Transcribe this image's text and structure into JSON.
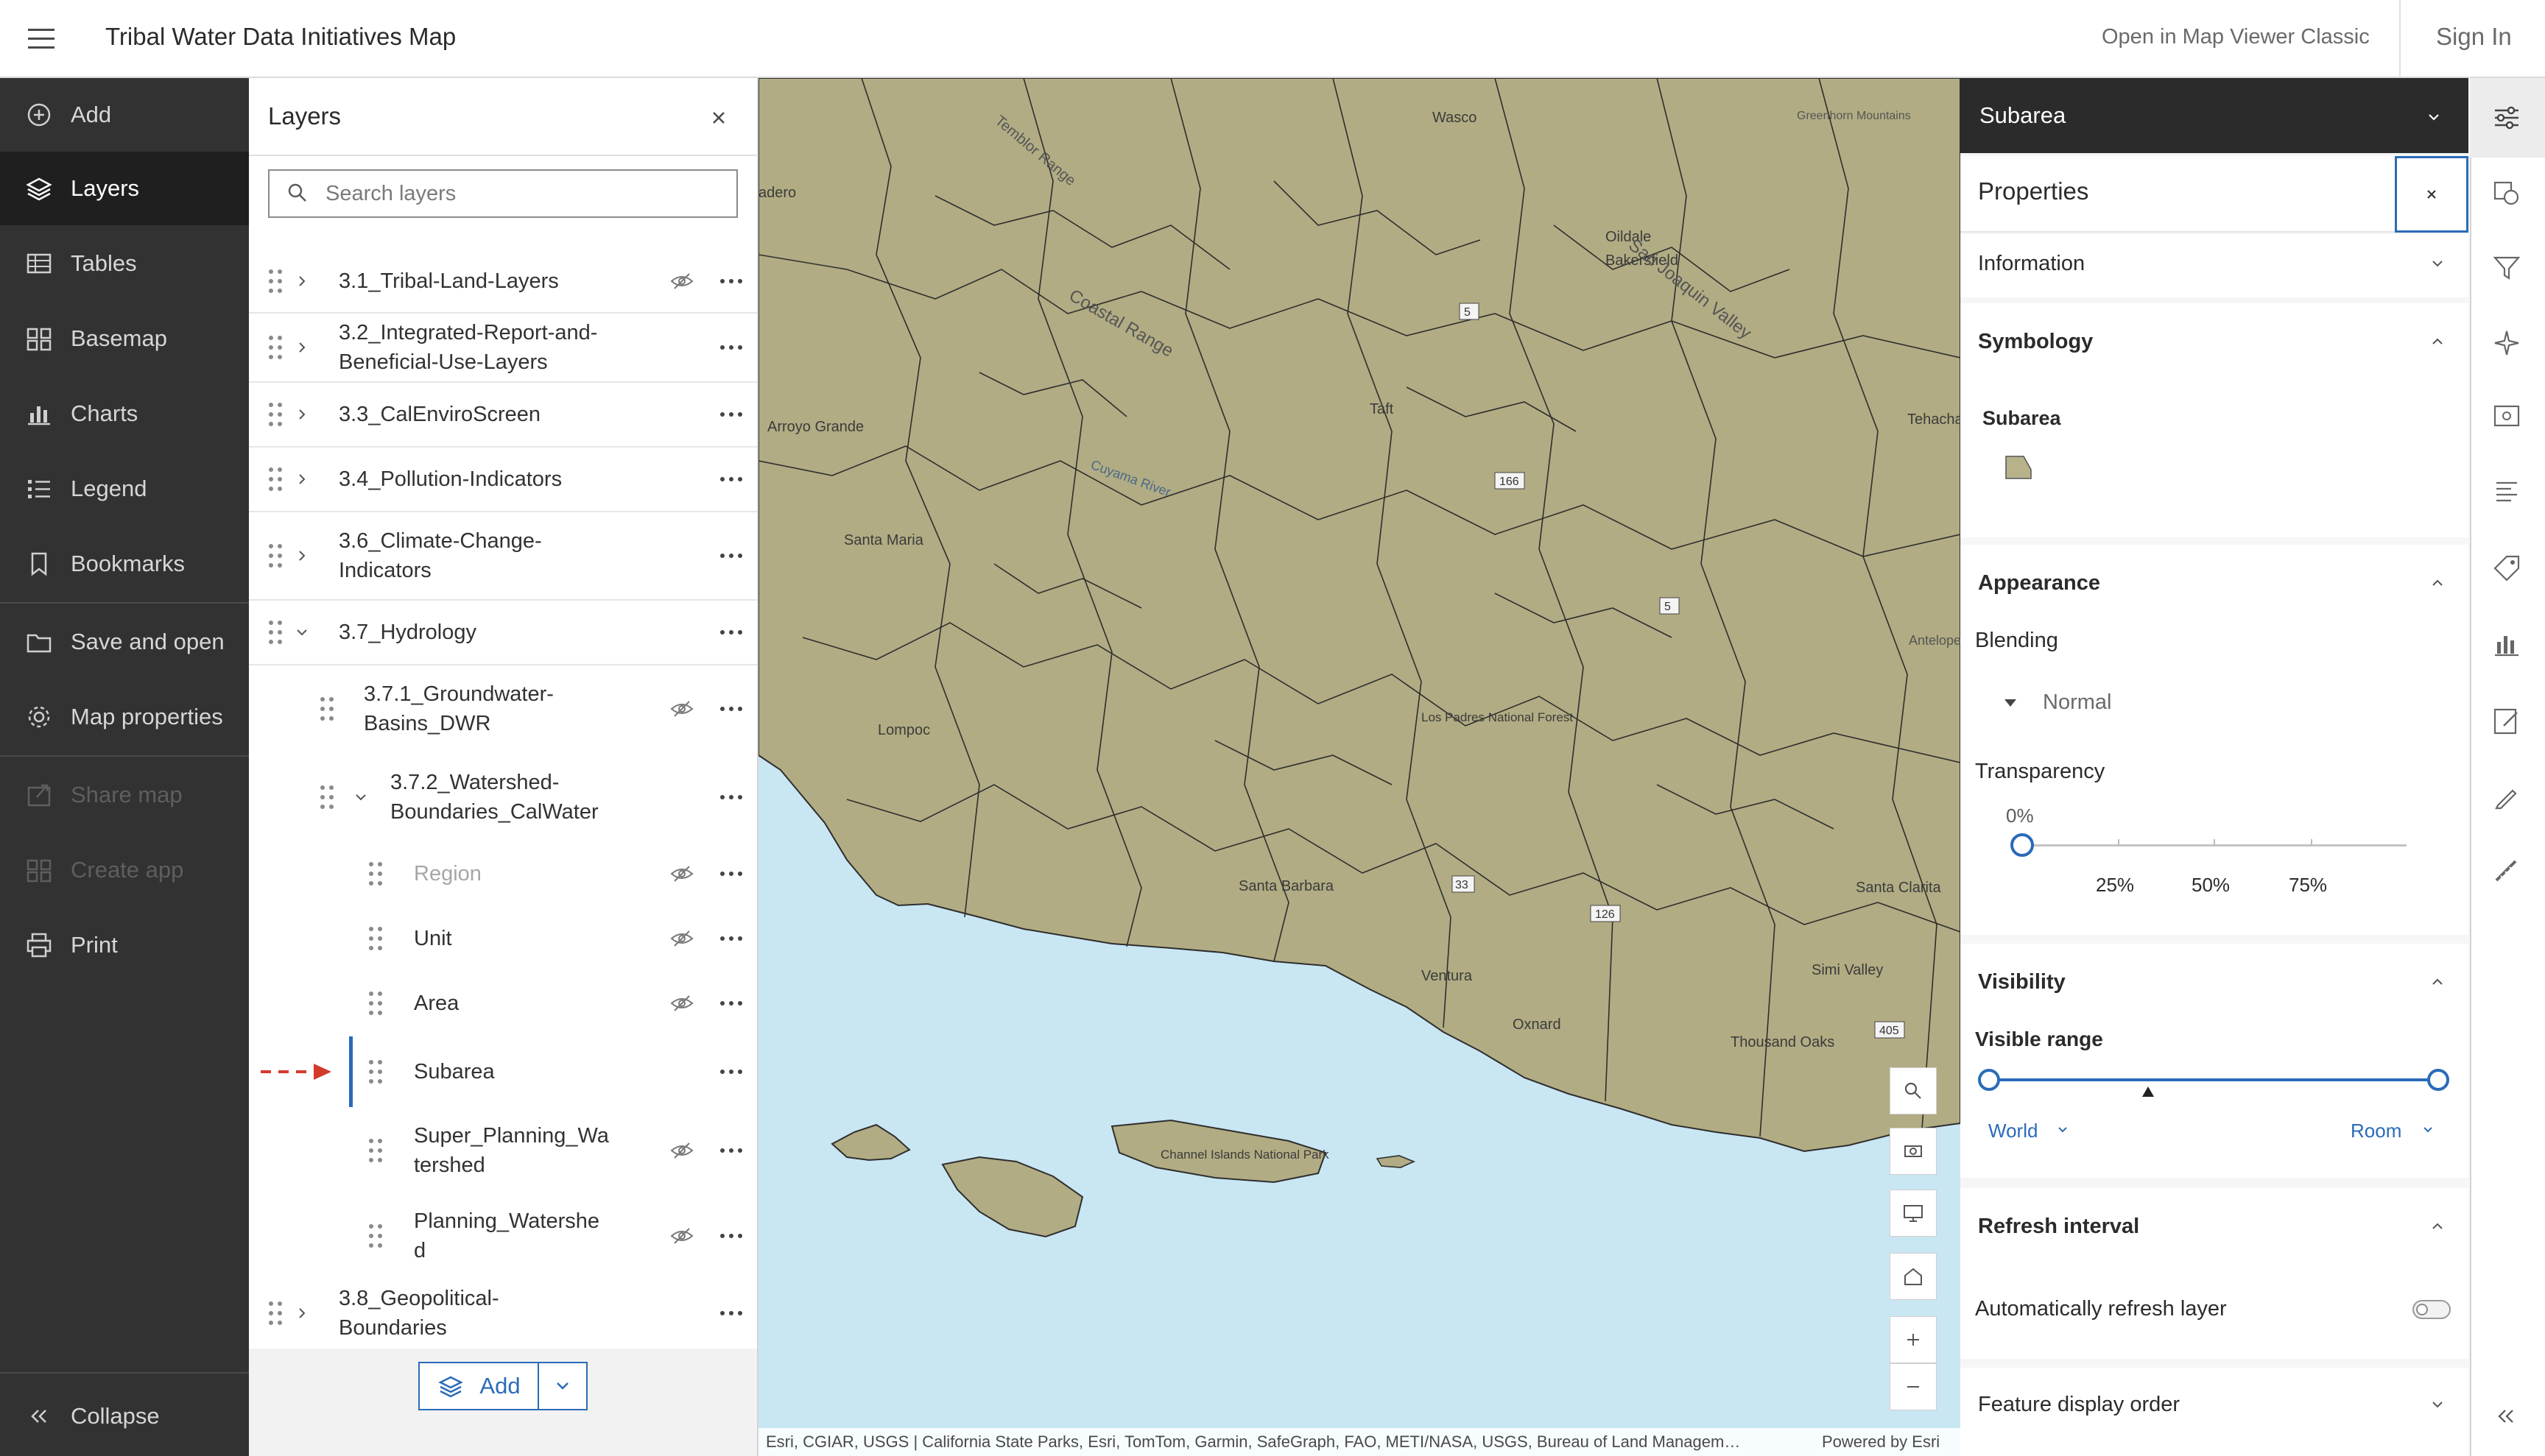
{
  "header": {
    "title": "Tribal Water Data Initiatives Map",
    "open_classic": "Open in Map Viewer Classic",
    "sign_in": "Sign In"
  },
  "nav": {
    "items": [
      {
        "label": "Add",
        "icon": "add-circle-icon",
        "state": "normal"
      },
      {
        "label": "Layers",
        "icon": "layers-icon",
        "state": "active"
      },
      {
        "label": "Tables",
        "icon": "table-icon",
        "state": "normal"
      },
      {
        "label": "Basemap",
        "icon": "basemap-icon",
        "state": "normal"
      },
      {
        "label": "Charts",
        "icon": "chart-icon",
        "state": "normal"
      },
      {
        "label": "Legend",
        "icon": "legend-icon",
        "state": "normal"
      },
      {
        "label": "Bookmarks",
        "icon": "bookmark-icon",
        "state": "normal"
      },
      {
        "label": "Save and open",
        "icon": "folder-icon",
        "state": "normal"
      },
      {
        "label": "Map properties",
        "icon": "gear-icon",
        "state": "normal"
      },
      {
        "label": "Share map",
        "icon": "share-icon",
        "state": "disabled"
      },
      {
        "label": "Create app",
        "icon": "apps-icon",
        "state": "disabled"
      },
      {
        "label": "Print",
        "icon": "print-icon",
        "state": "normal"
      }
    ],
    "collapse": "Collapse"
  },
  "layers": {
    "title": "Layers",
    "search_placeholder": "Search layers",
    "items": [
      {
        "line1": "3.1_Tribal-Land-Layers",
        "line2": ""
      },
      {
        "line1": "3.2_Integrated-Report-and-",
        "line2": "Beneficial-Use-Layers"
      },
      {
        "line1": "3.3_CalEnviroScreen",
        "line2": ""
      },
      {
        "line1": "3.4_Pollution-Indicators",
        "line2": ""
      },
      {
        "line1": "3.6_Climate-Change-",
        "line2": "Indicators"
      },
      {
        "line1": "3.7_Hydrology",
        "line2": ""
      },
      {
        "line1": "3.7.1_Groundwater-",
        "line2": "Basins_DWR"
      },
      {
        "line1": "3.7.2_Watershed-",
        "line2": "Boundaries_CalWater"
      },
      {
        "line1": "Region",
        "line2": ""
      },
      {
        "line1": "Unit",
        "line2": ""
      },
      {
        "line1": "Area",
        "line2": ""
      },
      {
        "line1": "Subarea",
        "line2": ""
      },
      {
        "line1": "Super_Planning_Wa",
        "line2": "tershed"
      },
      {
        "line1": "Planning_Watershe",
        "line2": "d"
      },
      {
        "line1": "3.8_Geopolitical-",
        "line2": "Boundaries"
      }
    ],
    "add_label": "Add"
  },
  "map": {
    "labels": [
      "Wasco",
      "Bakersfield",
      "Oildale",
      "Taft",
      "Arroyo Grande",
      "Santa Maria",
      "Lompoc",
      "Santa Barbara",
      "Ventura",
      "Oxnard",
      "Thousand Oaks",
      "Simi Valley",
      "Santa Clarita",
      "Tehachapi",
      "Los Padres National Forest",
      "Channel Islands National Park",
      "Coastal Range",
      "Temblor Range",
      "San Joaquin Valley",
      "Cuyama River",
      "Antelope",
      "Greenhorn Mountains",
      "adero"
    ],
    "roads": [
      "5",
      "166",
      "5",
      "33",
      "126",
      "405"
    ],
    "attribution": "Esri, CGIAR, USGS | California State Parks, Esri, TomTom, Garmin, SafeGraph, FAO, METI/NASA, USGS, Bureau of Land Managem…",
    "powered": "Powered by Esri"
  },
  "properties": {
    "layer_name": "Subarea",
    "title": "Properties",
    "information": "Information",
    "symbology": "Symbology",
    "symbol_label": "Subarea",
    "symbol_color": "#b7b28a",
    "appearance": "Appearance",
    "blending": "Blending",
    "blend_mode": "Normal",
    "transparency": "Transparency",
    "transparency_value": "0%",
    "transparency_ticks": [
      "25%",
      "50%",
      "75%"
    ],
    "visibility": "Visibility",
    "visible_range": "Visible range",
    "range_min": "World",
    "range_max": "Room",
    "refresh_interval": "Refresh interval",
    "auto_refresh": "Automatically refresh layer",
    "feature_order": "Feature display order"
  },
  "colors": {
    "accent": "#2a6bb8",
    "land": "#b2ad85",
    "water": "#c9e6f3",
    "nav_bg": "#323232",
    "arrow": "#d33a2c"
  }
}
